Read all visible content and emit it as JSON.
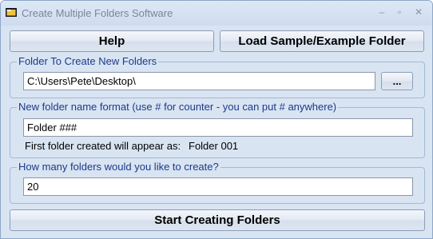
{
  "window": {
    "title": "Create Multiple Folders Software",
    "controls": {
      "minimize": "–",
      "maximize": "▫",
      "close": "✕"
    }
  },
  "buttons": {
    "help": "Help",
    "load_sample": "Load Sample/Example Folder",
    "browse": "...",
    "start": "Start Creating Folders"
  },
  "folder_group": {
    "title": "Folder To Create New Folders",
    "path_value": "C:\\Users\\Pete\\Desktop\\"
  },
  "format_group": {
    "title": "New folder name format (use # for counter - you can put # anywhere)",
    "format_value": "Folder ###",
    "preview_label": "First folder created will appear as:",
    "preview_value": "Folder 001"
  },
  "count_group": {
    "title": "How many folders would you like to create?",
    "count_value": "20"
  },
  "colors": {
    "group_title": "#1b3a8a",
    "background": "#d9e4f2",
    "title_text": "#7b8596"
  }
}
